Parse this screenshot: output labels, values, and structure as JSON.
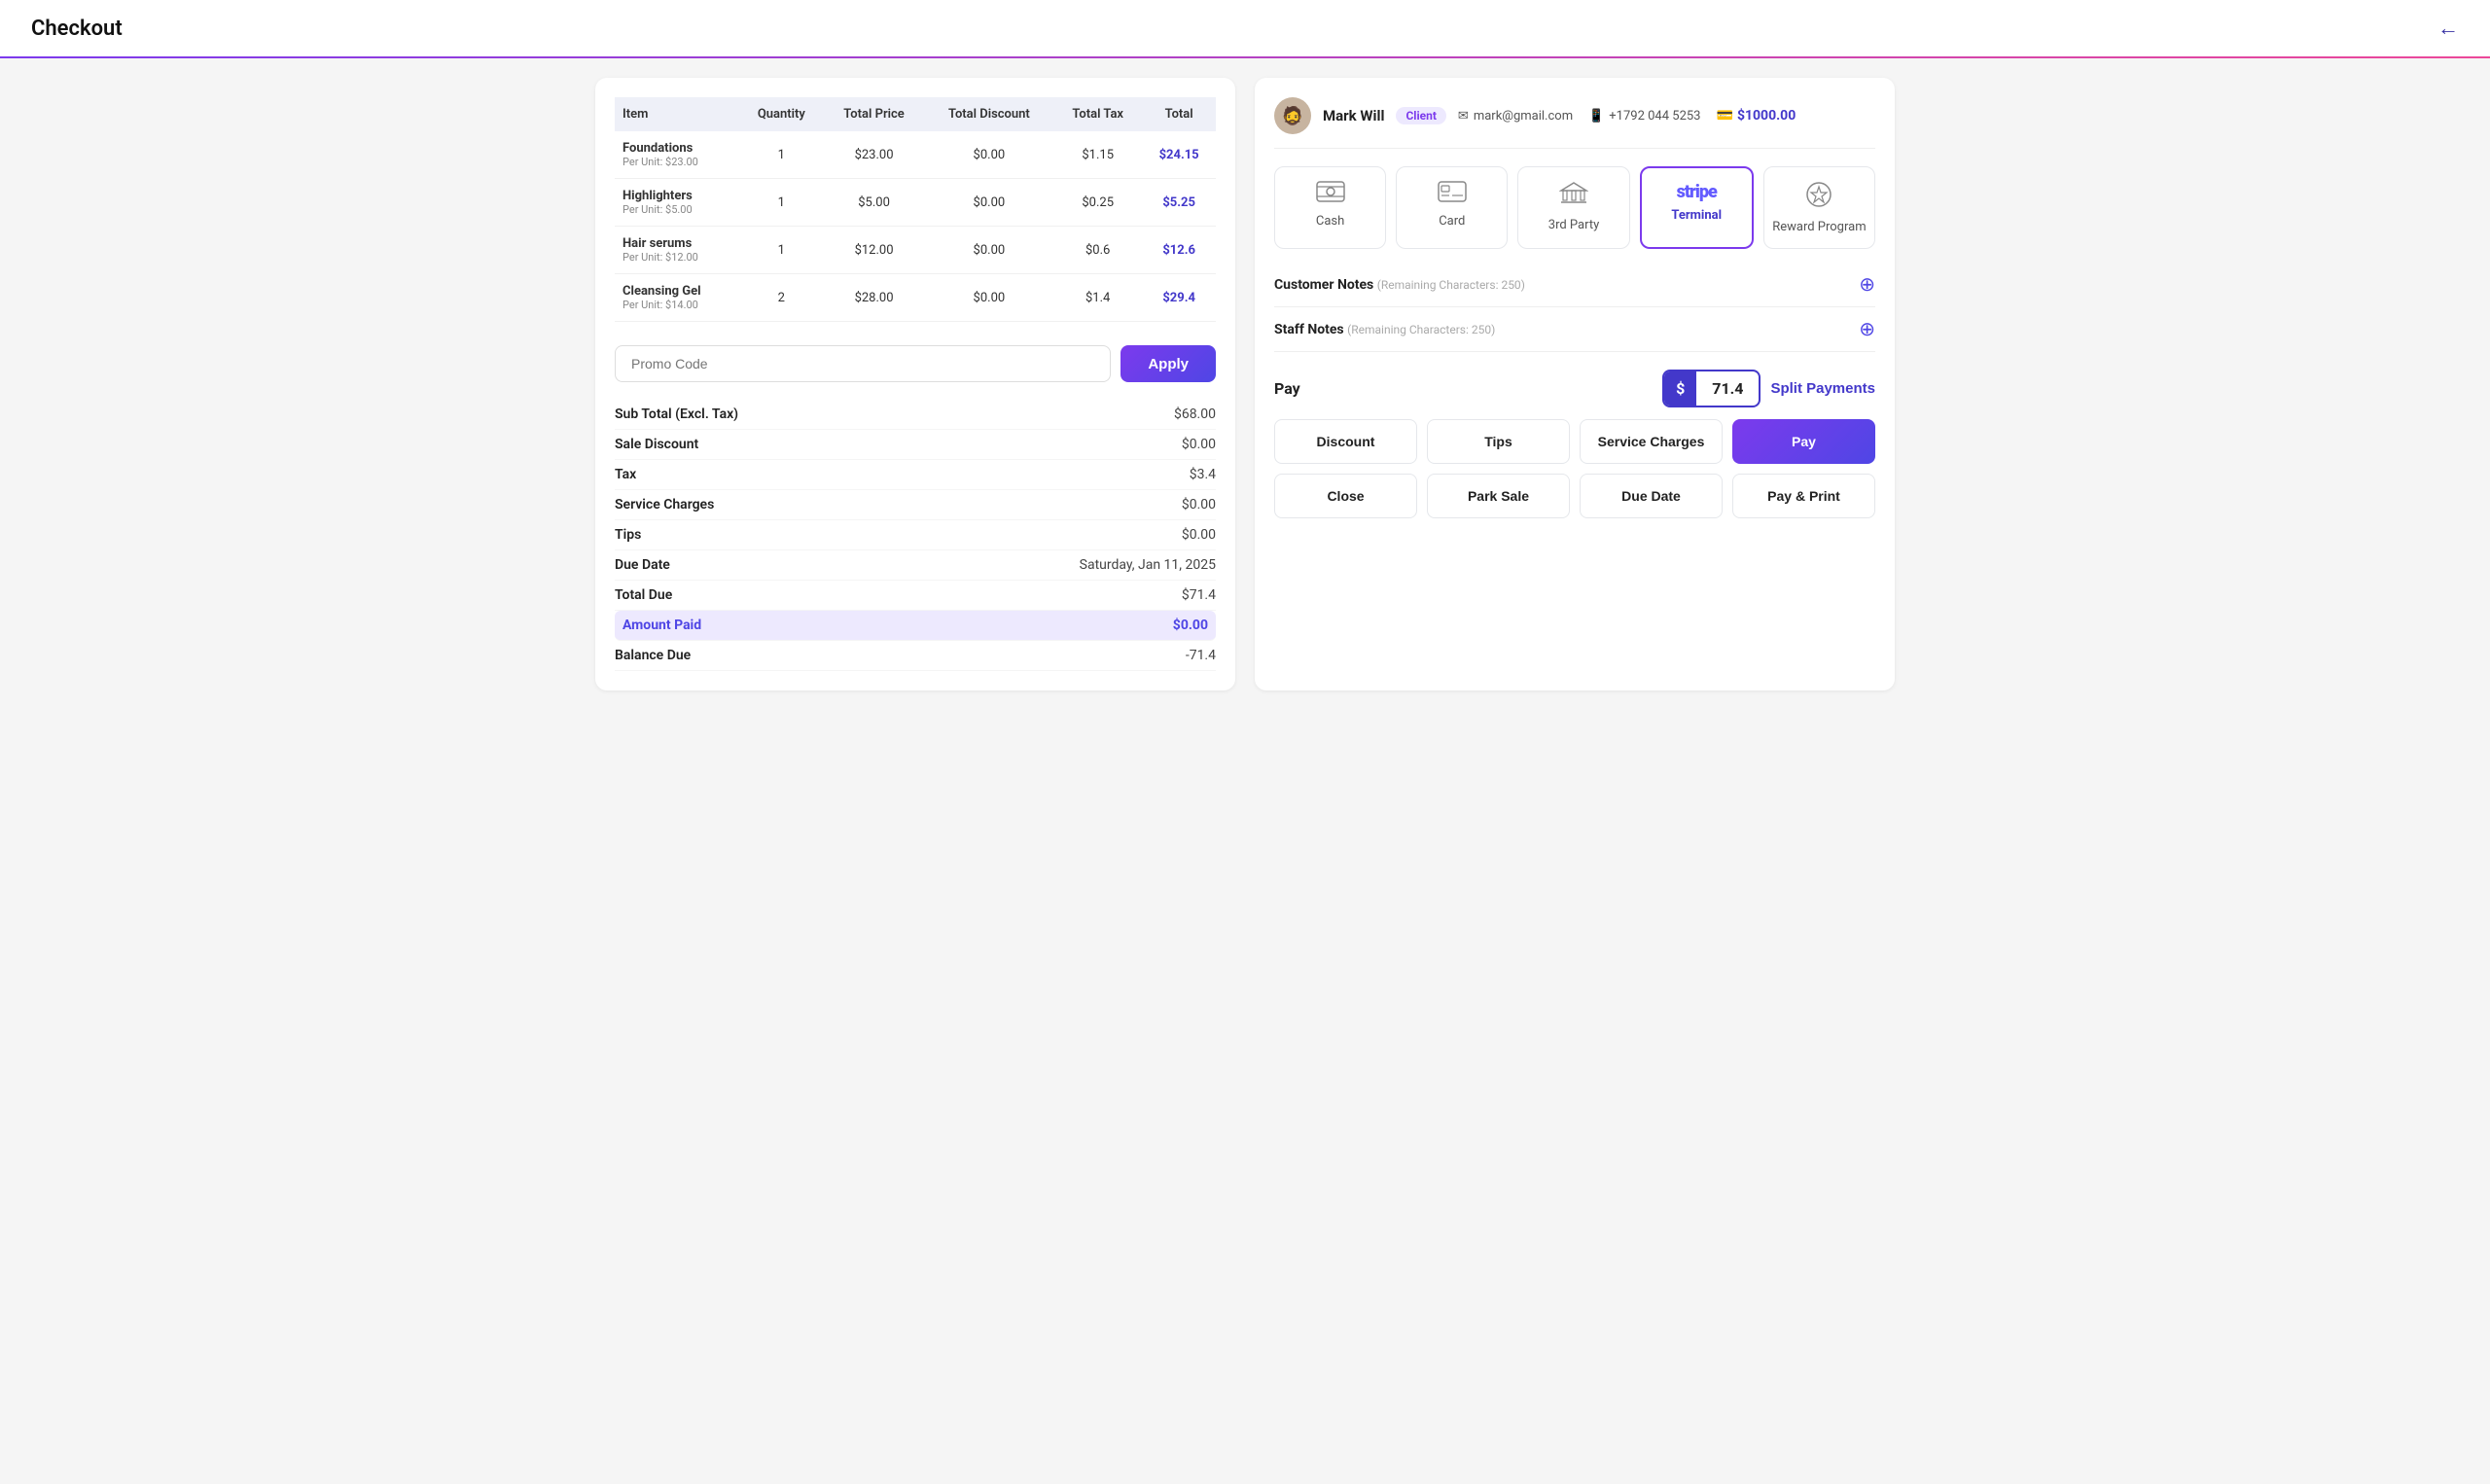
{
  "header": {
    "title": "Checkout",
    "back_icon": "←"
  },
  "table": {
    "columns": [
      "Item",
      "Quantity",
      "Total Price",
      "Total Discount",
      "Total Tax",
      "Total"
    ],
    "rows": [
      {
        "name": "Foundations",
        "unit": "Per Unit: $23.00",
        "quantity": "1",
        "totalPrice": "$23.00",
        "discount": "$0.00",
        "tax": "$1.15",
        "total": "$24.15"
      },
      {
        "name": "Highlighters",
        "unit": "Per Unit: $5.00",
        "quantity": "1",
        "totalPrice": "$5.00",
        "discount": "$0.00",
        "tax": "$0.25",
        "total": "$5.25"
      },
      {
        "name": "Hair serums",
        "unit": "Per Unit: $12.00",
        "quantity": "1",
        "totalPrice": "$12.00",
        "discount": "$0.00",
        "tax": "$0.6",
        "total": "$12.6"
      },
      {
        "name": "Cleansing Gel",
        "unit": "Per Unit: $14.00",
        "quantity": "2",
        "totalPrice": "$28.00",
        "discount": "$0.00",
        "tax": "$1.4",
        "total": "$29.4"
      }
    ]
  },
  "promo": {
    "placeholder": "Promo Code",
    "apply_label": "Apply"
  },
  "summary": {
    "rows": [
      {
        "label": "Sub Total (Excl. Tax)",
        "value": "$68.00"
      },
      {
        "label": "Sale Discount",
        "value": "$0.00"
      },
      {
        "label": "Tax",
        "value": "$3.4"
      },
      {
        "label": "Service Charges",
        "value": "$0.00"
      },
      {
        "label": "Tips",
        "value": "$0.00"
      },
      {
        "label": "Due Date",
        "value": "Saturday, Jan 11, 2025"
      },
      {
        "label": "Total Due",
        "value": "$71.4"
      },
      {
        "label": "Amount Paid",
        "value": "$0.00",
        "special": "amount-paid"
      },
      {
        "label": "Balance Due",
        "value": "-71.4"
      }
    ]
  },
  "customer": {
    "name": "Mark Will",
    "badge": "Client",
    "email": "mark@gmail.com",
    "phone": "+1792 044 5253",
    "balance": "$1000.00"
  },
  "payment_methods": [
    {
      "id": "cash",
      "label": "Cash",
      "icon": "cash"
    },
    {
      "id": "card",
      "label": "Card",
      "icon": "card"
    },
    {
      "id": "3rdparty",
      "label": "3rd Party",
      "icon": "bank"
    },
    {
      "id": "terminal",
      "label": "Terminal",
      "icon": "stripe",
      "active": true
    },
    {
      "id": "reward",
      "label": "Reward Program",
      "icon": "reward"
    }
  ],
  "notes": {
    "customer_label": "Customer Notes",
    "customer_remaining": "Remaining Characters: 250",
    "staff_label": "Staff Notes",
    "staff_remaining": "Remaining Characters: 250"
  },
  "pay_section": {
    "label": "Pay",
    "currency": "$",
    "amount": "71.4",
    "split_label": "Split Payments"
  },
  "action_buttons": {
    "discount": "Discount",
    "tips": "Tips",
    "service_charges": "Service Charges",
    "pay": "Pay",
    "close": "Close",
    "park_sale": "Park Sale",
    "due_date": "Due Date",
    "pay_print": "Pay & Print"
  }
}
